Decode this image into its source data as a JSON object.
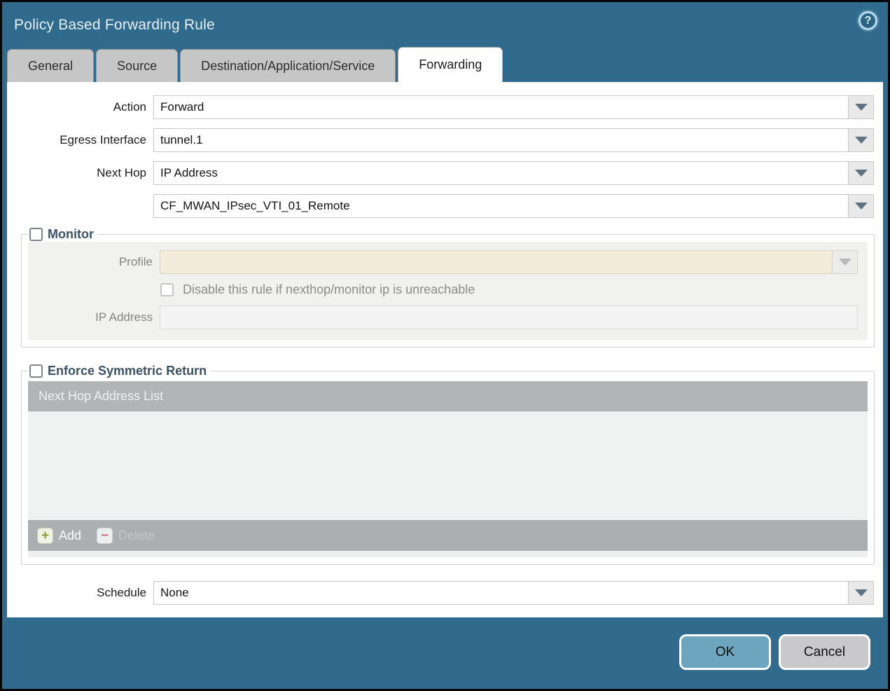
{
  "dialog": {
    "title": "Policy Based Forwarding Rule",
    "icons": {
      "help": "circled-question-mark",
      "dropdown": "chevron-down",
      "add": "plus",
      "delete": "minus"
    },
    "colors": {
      "frame_teal": "#306a8c",
      "ok_button": "#6da5bf",
      "cancel_button": "#c9c9cc",
      "disabled_field_beige": "#f3ecda",
      "section_label": "#3c5266",
      "table_header_bg": "#b1b5b8"
    }
  },
  "tabs": [
    {
      "label": "General",
      "active": false
    },
    {
      "label": "Source",
      "active": false
    },
    {
      "label": "Destination/Application/Service",
      "active": false
    },
    {
      "label": "Forwarding",
      "active": true
    }
  ],
  "form": {
    "action": {
      "label": "Action",
      "value": "Forward"
    },
    "egress_interface": {
      "label": "Egress Interface",
      "value": "tunnel.1"
    },
    "next_hop": {
      "label": "Next Hop",
      "value": "IP Address"
    },
    "next_hop_value": {
      "value": "CF_MWAN_IPsec_VTI_01_Remote"
    },
    "schedule": {
      "label": "Schedule",
      "value": "None"
    }
  },
  "monitor": {
    "label": "Monitor",
    "checked": false,
    "profile": {
      "label": "Profile",
      "value": ""
    },
    "disable_rule": {
      "label": "Disable this rule if nexthop/monitor ip is unreachable",
      "checked": false
    },
    "ip_address": {
      "label": "IP Address",
      "value": ""
    }
  },
  "enforce_symmetric_return": {
    "label": "Enforce Symmetric Return",
    "checked": false,
    "table": {
      "header": "Next Hop Address List",
      "rows": []
    },
    "add_label": "Add",
    "delete_label": "Delete"
  },
  "footer": {
    "ok_label": "OK",
    "cancel_label": "Cancel",
    "help_glyph": "?"
  }
}
